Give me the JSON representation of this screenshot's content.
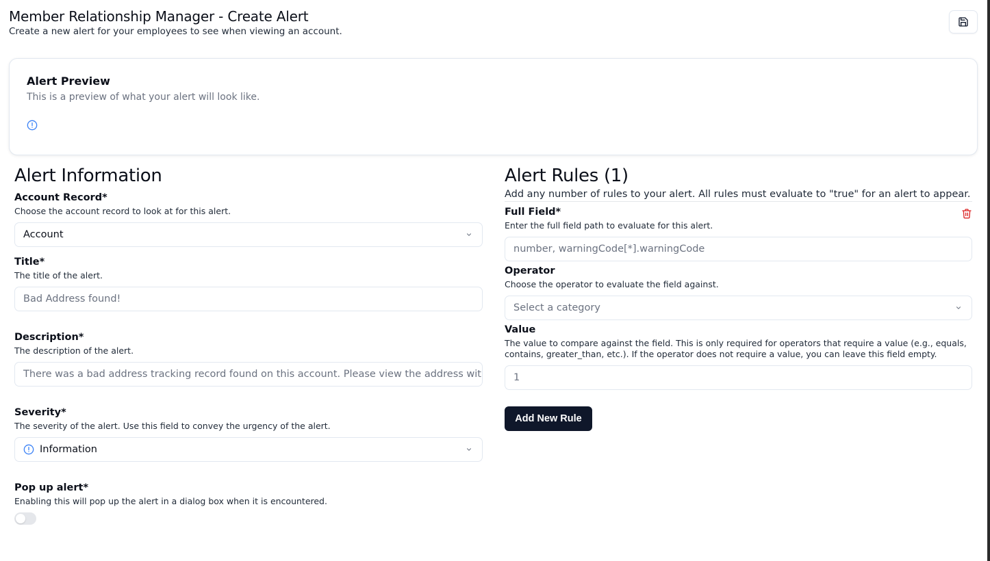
{
  "header": {
    "title": "Member Relationship Manager - Create Alert",
    "subtitle": "Create a new alert for your employees to see when viewing an account.",
    "save_icon": "save-icon"
  },
  "preview": {
    "title": "Alert Preview",
    "description": "This is a preview of what your alert will look like.",
    "icon": "info-icon",
    "icon_color": "#3b82f6"
  },
  "alert_information": {
    "heading": "Alert Information",
    "account_record": {
      "label": "Account Record*",
      "help": "Choose the account record to look at for this alert.",
      "selected": "Account"
    },
    "title": {
      "label": "Title*",
      "help": "The title of the alert.",
      "placeholder": "Bad Address found!"
    },
    "description": {
      "label": "Description*",
      "help": "The description of the alert.",
      "placeholder": "There was a bad address tracking record found on this account. Please view the address with t"
    },
    "severity": {
      "label": "Severity*",
      "help": "The severity of the alert. Use this field to convey the urgency of the alert.",
      "selected": "Information",
      "icon": "info-icon"
    },
    "popup": {
      "label": "Pop up alert*",
      "help": "Enabling this will pop up the alert in a dialog box when it is encountered.",
      "enabled": false
    }
  },
  "alert_rules": {
    "heading": "Alert Rules (1)",
    "subheading": "Add any number of rules to your alert. All rules must evaluate to \"true\" for an alert to appear.",
    "full_field": {
      "label": "Full Field*",
      "help": "Enter the full field path to evaluate for this alert.",
      "placeholder": "number, warningCode[*].warningCode"
    },
    "operator": {
      "label": "Operator",
      "help": "Choose the operator to evaluate the field against.",
      "placeholder": "Select a category"
    },
    "value": {
      "label": "Value",
      "help_line1": "The value to compare against the field. This is only required for operators that require a value (e.g., equals,",
      "help_line2": "contains, greater_than, etc.). If the operator does not require a value, you can leave this field empty.",
      "placeholder": "1"
    },
    "add_button": "Add New Rule",
    "delete_icon": "trash-icon",
    "delete_color": "#dc2626"
  }
}
